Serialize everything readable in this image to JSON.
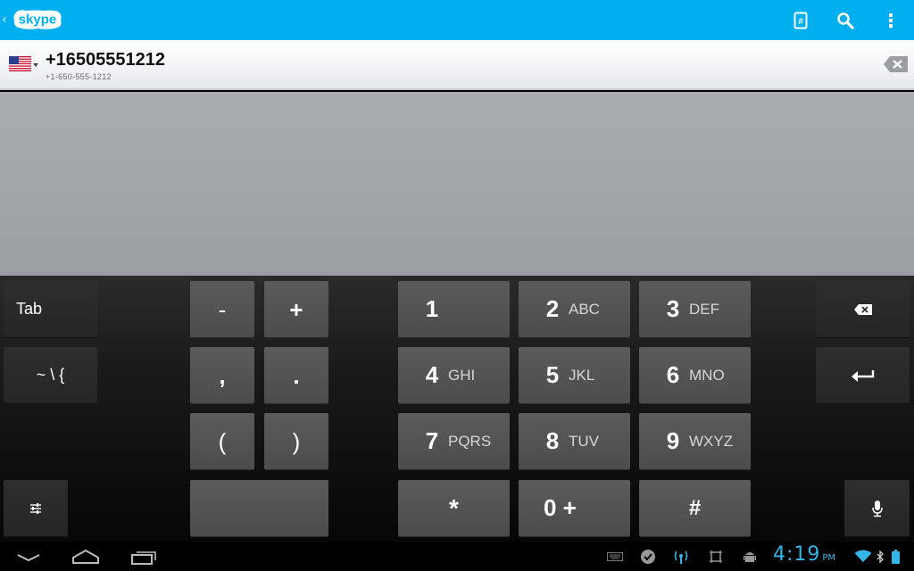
{
  "app": {
    "logo_text": "skype",
    "brand_color": "#00aff0"
  },
  "appbar": {
    "icons": [
      "dialpad-icon",
      "search-icon",
      "overflow-menu-icon"
    ]
  },
  "dialer": {
    "number": "+16505551212",
    "formatted": "+1-650-555-1212",
    "country": "United States",
    "clear_icon": "backspace-icon"
  },
  "keyboard": {
    "left": {
      "tab": "Tab",
      "symbols": "~ \\ {",
      "settings_icon": "settings-sliders-icon"
    },
    "symbols": {
      "minus": "-",
      "plus": "+",
      "comma": ",",
      "period": ".",
      "open_paren": "(",
      "close_paren": ")"
    },
    "digits": [
      {
        "d": "1",
        "l": ""
      },
      {
        "d": "2",
        "l": "ABC"
      },
      {
        "d": "3",
        "l": "DEF"
      },
      {
        "d": "4",
        "l": "GHI"
      },
      {
        "d": "5",
        "l": "JKL"
      },
      {
        "d": "6",
        "l": "MNO"
      },
      {
        "d": "7",
        "l": "PQRS"
      },
      {
        "d": "8",
        "l": "TUV"
      },
      {
        "d": "9",
        "l": "WXYZ"
      }
    ],
    "star": "*",
    "zero": "0 +",
    "hash": "#",
    "right": {
      "backspace_icon": "backspace-icon",
      "enter_icon": "enter-icon",
      "mic_icon": "microphone-icon"
    }
  },
  "statusbar": {
    "time": "4:19",
    "ampm": "PM",
    "accent": "#33b5e5",
    "icons": [
      "keyboard-icon",
      "skype-notification-icon",
      "hotspot-icon",
      "screenshot-icon",
      "android-debug-icon",
      "wifi-icon",
      "bluetooth-icon",
      "battery-icon"
    ]
  },
  "navbar": {
    "icons": [
      "back-icon",
      "home-icon",
      "recent-apps-icon"
    ]
  }
}
